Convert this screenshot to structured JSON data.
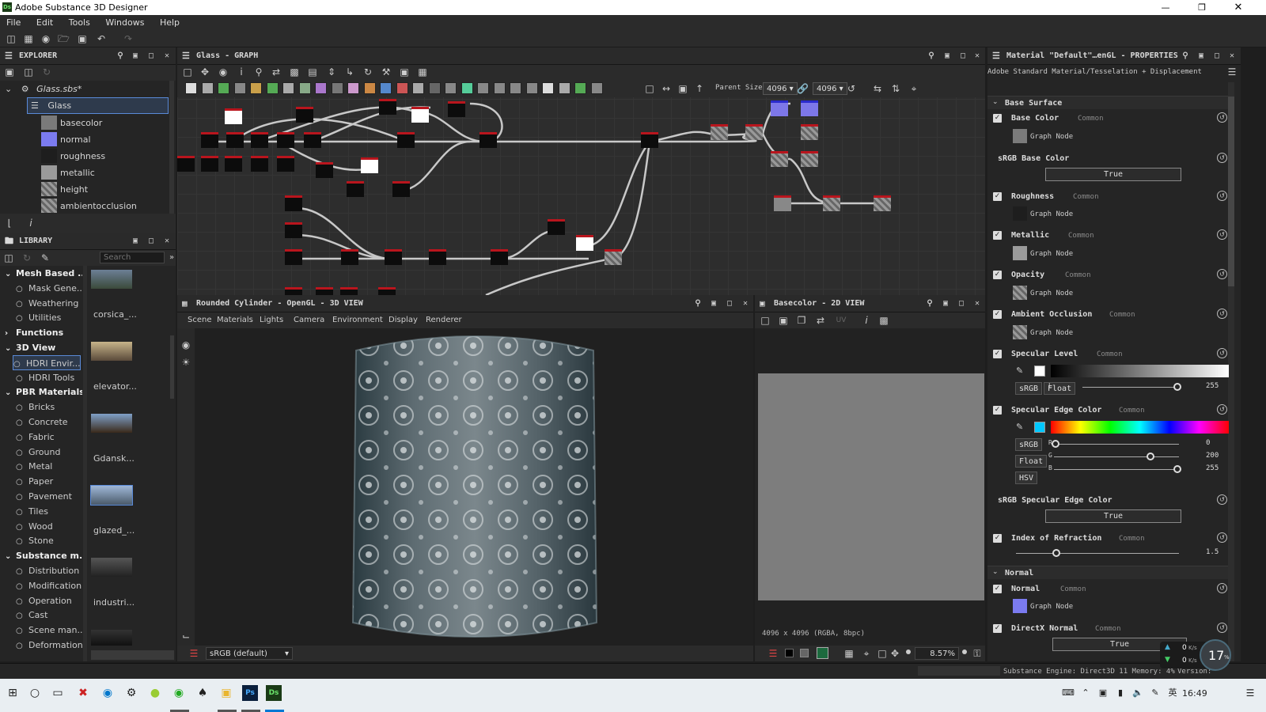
{
  "window": {
    "title": "Adobe Substance 3D Designer",
    "app_icon": "Ds"
  },
  "menu": [
    "File",
    "Edit",
    "Tools",
    "Windows",
    "Help"
  ],
  "explorer": {
    "title": "EXPLORER",
    "file": "Glass.sbs*",
    "graph": "Glass",
    "outputs": [
      {
        "label": "basecolor",
        "color": "#7a7a7a"
      },
      {
        "label": "normal",
        "color": "#7b7bf0"
      },
      {
        "label": "roughness",
        "color": "#1e1e1e"
      },
      {
        "label": "metallic",
        "color": "#9a9a9a"
      },
      {
        "label": "height",
        "color": "checker"
      },
      {
        "label": "ambientocclusion",
        "color": "checker"
      }
    ]
  },
  "library": {
    "title": "LIBRARY",
    "search_placeholder": "Search",
    "categories": [
      {
        "label": "Mesh Based ...",
        "bold": true
      },
      {
        "label": "Mask Gene...",
        "bold": false
      },
      {
        "label": "Weathering",
        "bold": false
      },
      {
        "label": "Utilities",
        "bold": false
      },
      {
        "label": "Functions",
        "bold": true
      },
      {
        "label": "3D View",
        "bold": true
      },
      {
        "label": "HDRI Envir...",
        "bold": false
      },
      {
        "label": "HDRI Tools",
        "bold": false
      },
      {
        "label": "PBR Materials",
        "bold": true
      },
      {
        "label": "Bricks",
        "bold": false
      },
      {
        "label": "Concrete",
        "bold": false
      },
      {
        "label": "Fabric",
        "bold": false
      },
      {
        "label": "Ground",
        "bold": false
      },
      {
        "label": "Metal",
        "bold": false
      },
      {
        "label": "Paper",
        "bold": false
      },
      {
        "label": "Pavement",
        "bold": false
      },
      {
        "label": "Tiles",
        "bold": false
      },
      {
        "label": "Wood",
        "bold": false
      },
      {
        "label": "Stone",
        "bold": false
      },
      {
        "label": "Substance m...",
        "bold": true
      },
      {
        "label": "Distribution",
        "bold": false
      },
      {
        "label": "Modification",
        "bold": false
      },
      {
        "label": "Operation",
        "bold": false
      },
      {
        "label": "Cast",
        "bold": false
      },
      {
        "label": "Scene man...",
        "bold": false
      },
      {
        "label": "Deformation",
        "bold": false
      }
    ],
    "thumbs": [
      "corsica_...",
      "elevator...",
      "Gdansk...",
      "glazed_...",
      "industri..."
    ]
  },
  "graph_panel": {
    "title": "Glass - GRAPH",
    "parent_size_label": "Parent Size:",
    "parent_size": "4096",
    "size": "4096"
  },
  "view3d": {
    "title": "Rounded Cylinder - OpenGL - 3D VIEW",
    "menu": [
      "Scene",
      "Materials",
      "Lights",
      "Camera",
      "Environment",
      "Display",
      "Renderer"
    ],
    "colorspace": "sRGB (default)"
  },
  "view2d": {
    "title": "Basecolor - 2D VIEW",
    "info": "4096 x 4096 (RGBA, 8bpc)",
    "zoom": "8.57%"
  },
  "properties": {
    "title": "Material \"Default\"…enGL - PROPERTIES",
    "subtitle": "Adobe Standard Material/Tesselation + Displacement",
    "section_base": "Base Surface",
    "section_normal": "Normal",
    "common": "Common",
    "graph_node": "Graph Node",
    "true_label": "True",
    "base_color": "Base Color",
    "srgb_base_color": "sRGB Base Color",
    "roughness": "Roughness",
    "metallic": "Metallic",
    "opacity": "Opacity",
    "ambient_occlusion": "Ambient Occlusion",
    "specular_level": "Specular Level",
    "spec_level_value": "255",
    "spec_level_channel": "L",
    "srgb": "sRGB",
    "float": "Float",
    "hsv": "HSV",
    "specular_edge_color": "Specular Edge Color",
    "r_value": "0",
    "g_value": "200",
    "b_value": "255",
    "r_lbl": "R",
    "g_lbl": "G",
    "b_lbl": "B",
    "srgb_spec_edge": "sRGB Specular Edge Color",
    "ior": "Index of Refraction",
    "ior_value": "1.5",
    "normal": "Normal",
    "directx_normal": "DirectX Normal",
    "spec_edge_hex": "#00c8ff"
  },
  "status": {
    "engine": "Substance Engine: Direct3D 11 Memory: 4%",
    "version": "Version:",
    "net_up": "0",
    "net_down": "0",
    "net_unit": "K/s",
    "cpu": "17",
    "cpu_unit": "%"
  },
  "taskbar": {
    "time": "16:49",
    "lang": "英"
  }
}
